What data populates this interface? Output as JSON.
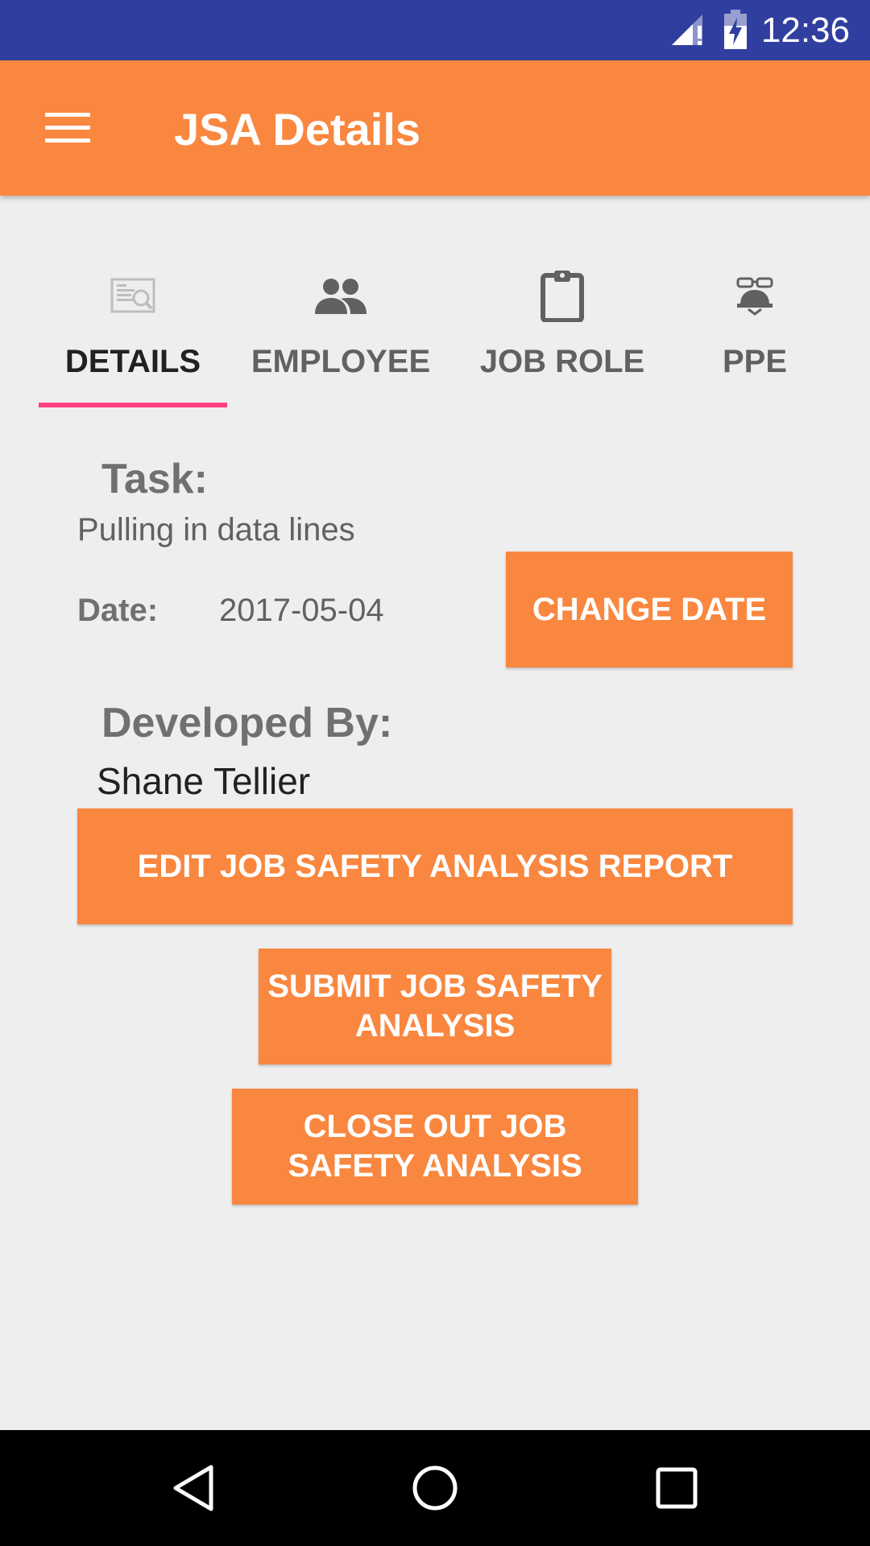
{
  "status_bar": {
    "time": "12:36"
  },
  "app_bar": {
    "title": "JSA Details"
  },
  "tabs": [
    {
      "label": "DETAILS",
      "icon": "document-search-icon",
      "active": true
    },
    {
      "label": "EMPLOYEE",
      "icon": "people-icon",
      "active": false
    },
    {
      "label": "JOB ROLE",
      "icon": "clipboard-icon",
      "active": false
    },
    {
      "label": "PPE",
      "icon": "hardhat-goggles-icon",
      "active": false
    }
  ],
  "details": {
    "task_label": "Task:",
    "task_value": "Pulling in data lines",
    "date_label": "Date:",
    "date_value": "2017-05-04",
    "change_date_label": "CHANGE DATE",
    "developed_by_label": "Developed By:",
    "developed_by_value": "Shane Tellier"
  },
  "actions": {
    "edit_label": "EDIT JOB SAFETY ANALYSIS REPORT",
    "submit_label": "SUBMIT JOB SAFETY ANALYSIS",
    "close_label": "CLOSE OUT JOB SAFETY ANALYSIS"
  },
  "colors": {
    "status_bar": "#303f9f",
    "accent": "#f9873f",
    "tab_indicator": "#ff4081",
    "background": "#eeeeee"
  }
}
